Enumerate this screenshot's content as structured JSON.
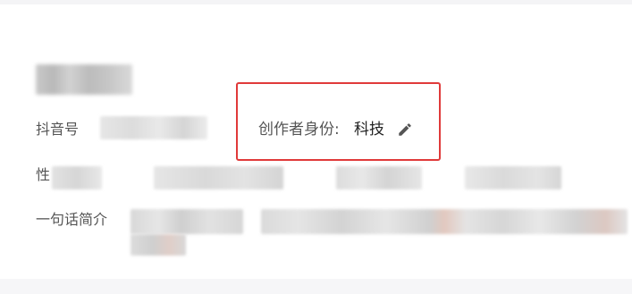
{
  "profile": {
    "douyin_label": "抖音号",
    "gender_label": "性",
    "bio_label": "一句话简介",
    "creator_identity_label": "创作者身份:",
    "creator_identity_value": "科技"
  },
  "icons": {
    "edit": "pencil-edit-icon"
  },
  "colors": {
    "highlight_border": "#e03a3a",
    "label_text": "#555555",
    "value_text": "#222222"
  }
}
